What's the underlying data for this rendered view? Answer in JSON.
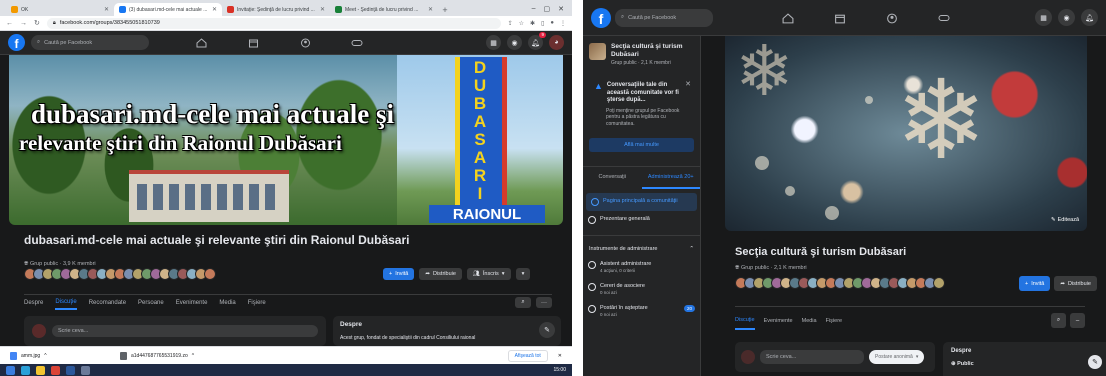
{
  "left": {
    "browser": {
      "tabs": [
        {
          "label": "OK",
          "color": "#f29900",
          "active": false
        },
        {
          "label": "(3) dubasari.md-cele mai actuale ...",
          "color": "#1877f2",
          "active": true
        },
        {
          "label": "Invitaţie: Şedinţă de lucru privind ...",
          "color": "#d93025",
          "active": false
        },
        {
          "label": "Meet - Şedinţă de lucru privind ...",
          "color": "#188038",
          "active": false
        }
      ],
      "url": "facebook.com/groups/383455051810739"
    },
    "facebook": {
      "search_placeholder": "Caută pe Facebook",
      "notification_count": "9"
    },
    "cover": {
      "title_line1": "dubasari.md-cele mai actuale şi",
      "title_line2": "relevante ştiri din Raionul Dubăsari",
      "pylon_text": "DUBASARI",
      "sign_text": "RAIONUL"
    },
    "group": {
      "title": "dubasari.md-cele mai actuale şi relevante ştiri din Raionul Dubăsari",
      "meta": "Grup public · 3,9 K membri",
      "invite_label": "Invită",
      "share_label": "Distribuie",
      "joined_label": "Înscris",
      "tabs": [
        "Despre",
        "Discuţie",
        "Recomandate",
        "Persoane",
        "Evenimente",
        "Media",
        "Fişiere"
      ],
      "active_tab": "Discuţie"
    },
    "composer_placeholder": "Scrie ceva...",
    "about": {
      "heading": "Despre",
      "text": "Acest grup, fondat de specialiştii din cadrul Consiliului raional"
    },
    "downloads": {
      "items": [
        "amm.jpg",
        "a1d447687765531919.zo"
      ],
      "show_all": "Afişează tot"
    },
    "taskbar_time": "15:00"
  },
  "right": {
    "facebook": {
      "search_placeholder": "Caută pe Facebook"
    },
    "sidebar": {
      "group_name": "Secţia cultură şi turism Dubăsari",
      "group_meta": "Grup public · 2,1 K membri",
      "notice_title": "Conversaţiile tale din această comunitate vor fi şterse după...",
      "notice_text": "Poţi menţine grupul pe Facebook pentru a păstra legătura cu comunitatea.",
      "more_button": "Află mai multe",
      "segments": [
        "Conversaţii",
        "Administrează"
      ],
      "segment_count": "20+",
      "active_segment": "Administrează",
      "items": [
        {
          "label": "Pagina principală a comunităţii"
        },
        {
          "label": "Prezentare generală"
        }
      ],
      "tools_heading": "Instrumente de administrare",
      "tools": [
        {
          "label": "Asistent administrare",
          "sub": "4 acţiuni, 0 criterii"
        },
        {
          "label": "Cereri de asociere",
          "sub": "0 noi azi"
        },
        {
          "label": "Postări în aşteptare",
          "sub": "0 noi azi",
          "count": "20"
        }
      ]
    },
    "cover_edit": "Editează",
    "group": {
      "title": "Secţia cultură şi turism Dubăsari",
      "meta": "Grup public · 2,1 K membri",
      "invite_label": "Invită",
      "share_label": "Distribuie",
      "tabs": [
        "Discuţie",
        "Evenimente",
        "Media",
        "Fişiere"
      ],
      "active_tab": "Discuţie"
    },
    "composer_placeholder": "Scrie ceva...",
    "anonymous_label": "Postare anonimă",
    "about": {
      "heading": "Despre",
      "privacy": "Public"
    }
  }
}
